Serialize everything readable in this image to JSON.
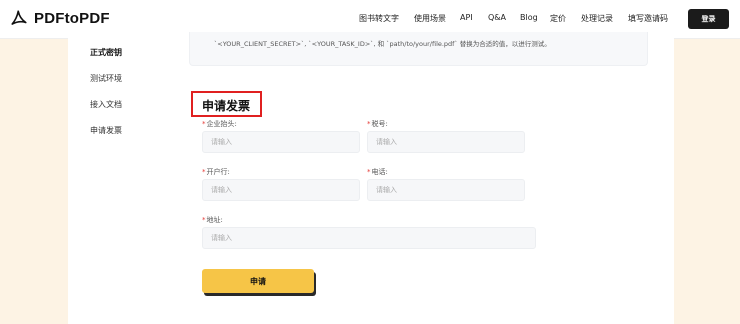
{
  "brand": {
    "name": "PDFtoPDF"
  },
  "nav": {
    "items": [
      "图书转文字",
      "使用场景",
      "API",
      "Q&A",
      "Blog",
      "定价",
      "处理记录",
      "填写邀请码"
    ],
    "login": "登录"
  },
  "sidebar": {
    "items": [
      {
        "label": "正式密钥",
        "active": true
      },
      {
        "label": "测试环境",
        "active": false
      },
      {
        "label": "接入文档",
        "active": false
      },
      {
        "label": "申请发票",
        "active": false
      }
    ]
  },
  "code_note": "`<YOUR_CLIENT_SECRET>`, `<YOUR_TASK_ID>`, 和 `path/to/your/file.pdf` 替换为合适的值，以进行测试。",
  "invoice": {
    "title": "申请发票",
    "fields": {
      "company": {
        "label": "企业抬头:",
        "placeholder": "请输入"
      },
      "tax_id": {
        "label": "税号:",
        "placeholder": "请输入"
      },
      "bank": {
        "label": "开户行:",
        "placeholder": "请输入"
      },
      "phone": {
        "label": "电话:",
        "placeholder": "请输入"
      },
      "address": {
        "label": "地址:",
        "placeholder": "请输入"
      }
    },
    "required_mark": "*",
    "submit": "申请"
  },
  "colors": {
    "accent_button": "#f6c547",
    "highlight_box": "#e02020",
    "page_background": "#fdf3e4"
  }
}
